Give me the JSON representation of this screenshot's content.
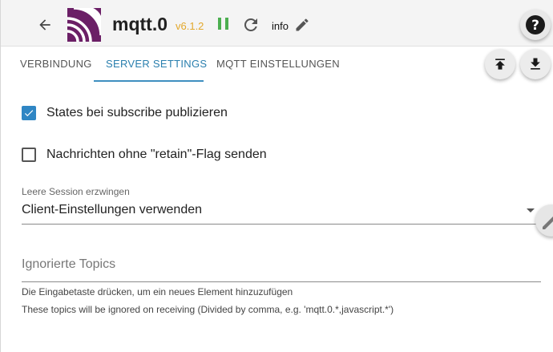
{
  "header": {
    "title": "mqtt.0",
    "version": "v6.1.2",
    "loglevel": "info",
    "help_label": "?"
  },
  "tabs": [
    {
      "label": "VERBINDUNG"
    },
    {
      "label": "SERVER SETTINGS"
    },
    {
      "label": "MQTT EINSTELLUNGEN"
    }
  ],
  "form": {
    "publish_states": {
      "label": "States bei subscribe publizieren",
      "checked": true
    },
    "no_retain": {
      "label": "Nachrichten ohne \"retain\"-Flag senden",
      "checked": false
    },
    "session": {
      "label": "Leere Session erzwingen",
      "value": "Client-Einstellungen verwenden"
    },
    "ignored_topics": {
      "placeholder": "Ignorierte Topics",
      "helper": "Die Eingabetaste drücken, um ein neues Element hinzuzufügen",
      "description": "These topics will be ignored on receiving (Divided by comma, e.g. 'mqtt.0.*,javascript.*')"
    }
  },
  "colors": {
    "accent": "#2a7fae",
    "logo": "#6b1f66",
    "version": "#e3a82b",
    "running": "#4caf50"
  },
  "icons": [
    "arrow-left-icon",
    "adapter-logo-icon",
    "pause-icon",
    "reload-icon",
    "pencil-icon",
    "help-icon",
    "upload-icon",
    "download-icon",
    "check-icon",
    "chevron-down-icon"
  ]
}
